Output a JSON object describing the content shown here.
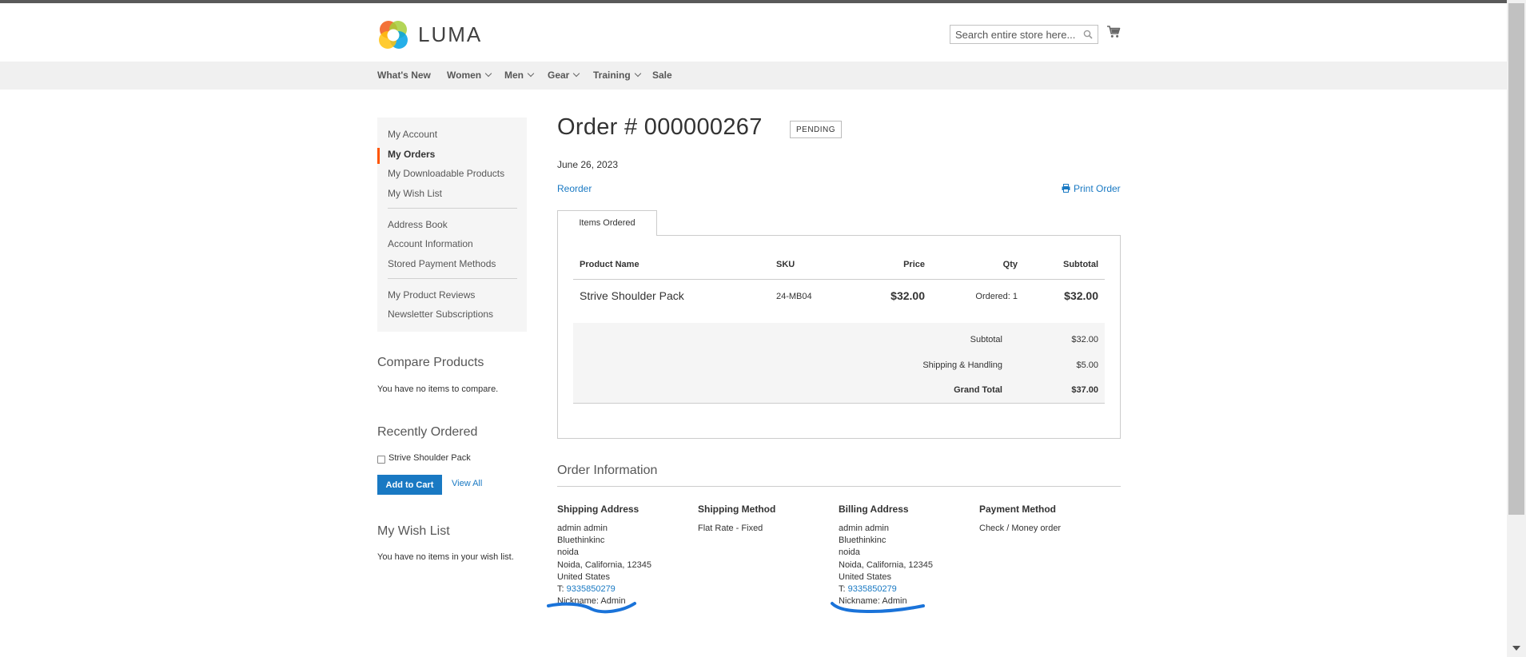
{
  "header": {
    "logo_text": "LUMA",
    "search_placeholder": "Search entire store here...",
    "icons": [
      "luma-logo-icon",
      "search-icon",
      "cart-icon"
    ]
  },
  "nav": {
    "items": [
      {
        "label": "What's New"
      },
      {
        "label": "Women"
      },
      {
        "label": "Men"
      },
      {
        "label": "Gear"
      },
      {
        "label": "Training"
      },
      {
        "label": "Sale"
      }
    ]
  },
  "sidebar": {
    "items": [
      {
        "label": "My Account"
      },
      {
        "label": "My Orders"
      },
      {
        "label": "My Downloadable Products"
      },
      {
        "label": "My Wish List"
      },
      {
        "label": "Address Book"
      },
      {
        "label": "Account Information"
      },
      {
        "label": "Stored Payment Methods"
      },
      {
        "label": "My Product Reviews"
      },
      {
        "label": "Newsletter Subscriptions"
      }
    ],
    "compare": {
      "title": "Compare Products",
      "text": "You have no items to compare."
    },
    "recent": {
      "title": "Recently Ordered",
      "item": "Strive Shoulder Pack",
      "add_label": "Add to Cart",
      "view_all": "View All"
    },
    "wishlist": {
      "title": "My Wish List",
      "text": "You have no items in your wish list."
    }
  },
  "order": {
    "title": "Order # 000000267",
    "status": "PENDING",
    "date": "June 26, 2023",
    "reorder": "Reorder",
    "print": "Print Order",
    "tab": "Items Ordered",
    "columns": {
      "name": "Product Name",
      "sku": "SKU",
      "price": "Price",
      "qty": "Qty",
      "subtotal": "Subtotal"
    },
    "items": [
      {
        "name": "Strive Shoulder Pack",
        "sku": "24-MB04",
        "price": "$32.00",
        "qty": "Ordered: 1",
        "subtotal": "$32.00"
      }
    ],
    "totals": [
      {
        "label": "Subtotal",
        "value": "$32.00"
      },
      {
        "label": "Shipping & Handling",
        "value": "$5.00"
      },
      {
        "label": "Grand Total",
        "value": "$37.00"
      }
    ]
  },
  "info": {
    "title": "Order Information",
    "shipping_address": {
      "title": "Shipping Address",
      "lines": [
        "admin admin",
        "Bluethinkinc",
        "noida",
        "Noida, California, 12345",
        "United States"
      ],
      "phone_prefix": "T:",
      "phone": "9335850279",
      "nickname": "Nickname: Admin"
    },
    "shipping_method": {
      "title": "Shipping Method",
      "text": "Flat Rate - Fixed"
    },
    "billing_address": {
      "title": "Billing Address",
      "lines": [
        "admin admin",
        "Bluethinkinc",
        "noida",
        "Noida, California, 12345",
        "United States"
      ],
      "phone_prefix": "T:",
      "phone": "9335850279",
      "nickname": "Nickname: Admin"
    },
    "payment_method": {
      "title": "Payment Method",
      "text": "Check / Money order"
    }
  },
  "colors": {
    "accent": "#1979c3",
    "active_marker": "#ff5501",
    "annotation": "#1a73d9",
    "nav_bg": "#f0f0f0"
  }
}
